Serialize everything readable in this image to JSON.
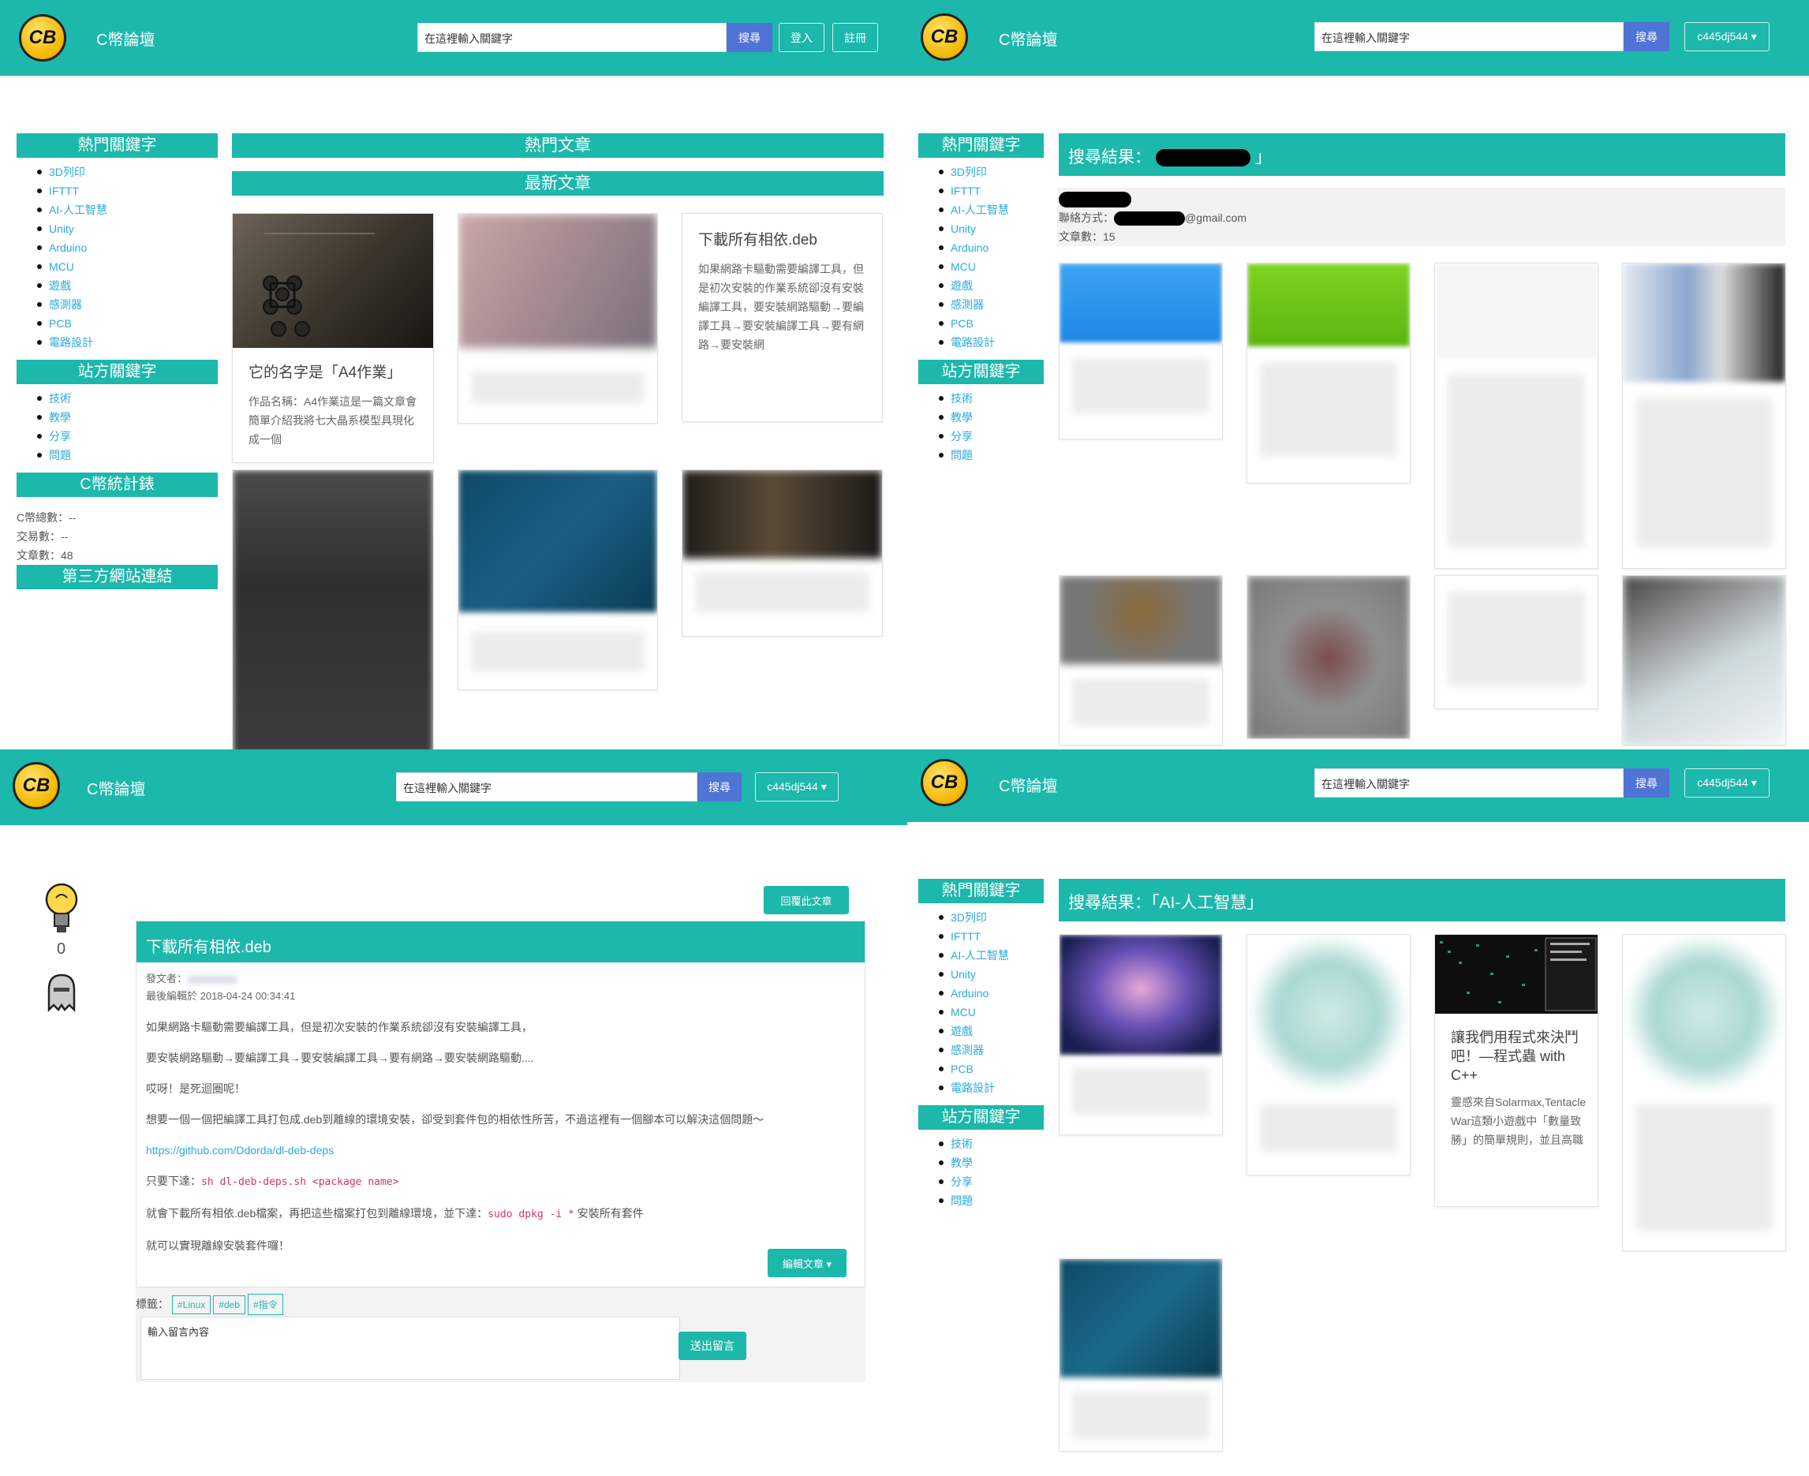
{
  "nav": {
    "brand": "C幣論壇",
    "logo_text": "CB",
    "search_placeholder": "在這裡輸入關鍵字",
    "search_btn": "搜尋",
    "login": "登入",
    "register": "註冊",
    "user_menu": "c445dj544 ▾"
  },
  "sidebar": {
    "hot_title": "熱門關鍵字",
    "hot_items": [
      "3D列印",
      "IFTTT",
      "AI-人工智慧",
      "Unity",
      "Arduino",
      "MCU",
      "遊戲",
      "感測器",
      "PCB",
      "電路設計"
    ],
    "site_title": "站方關鍵字",
    "site_items": [
      "技術",
      "教學",
      "分享",
      "問題"
    ],
    "stats_title": "C幣統計錶",
    "stats": [
      "C幣總數：--",
      "交易數：--",
      "文章數：48"
    ],
    "links_title": "第三方網站連結"
  },
  "home": {
    "hot_articles": "熱門文章",
    "latest_articles": "最新文章",
    "card1_title": "它的名字是「A4作業」",
    "card1_text": "作品名稱：A4作業這是一篇文章會簡單介紹我將七大晶系模型具現化成一個",
    "card3_title": "下載所有相依.deb",
    "card3_text": "如果網路卡驅動需要編譯工具，但是初次安裝的作業系統卻沒有安裝編譯工具，要安裝網路驅動→要編譯工具→要安裝編譯工具→要有網路→要安裝網"
  },
  "profile": {
    "result_label": "搜尋結果：",
    "result_close": "」",
    "contact_label": "聯絡方式：",
    "email_suffix": "@gmail.com",
    "article_count": "文章數：15"
  },
  "article": {
    "reply_btn": "回覆此文章",
    "title": "下載所有相依.deb",
    "author_label": "發文者：",
    "edited": "最後編輯於 2018-04-24 00:34:41",
    "vote_count": "0",
    "p1": "如果網路卡驅動需要編譯工具，但是初次安裝的作業系統卻沒有安裝編譯工具，",
    "p2": "要安裝網路驅動→要編譯工具→要安裝編譯工具→要有網路→要安裝網路驅動....",
    "p3": "哎呀！是死迴圈呢！",
    "p4": "想要一個一個把編譯工具打包成.deb到離線的環境安裝，卻受到套件包的相依性所苦，不過這裡有一個腳本可以解決這個問題～",
    "link": "https://github.com/Ddorda/dl-deb-deps",
    "p6_prefix": "只要下達：",
    "p6_code": "sh dl-deb-deps.sh <package name>",
    "p7_prefix": "就會下載所有相依.deb檔案，再把這些檔案打包到離線環境，並下達：",
    "p7_code": "sudo dpkg -i *",
    "p7_suffix": "安裝所有套件",
    "p8": "就可以實現離線安裝套件囉！",
    "edit_btn": "編輯文章 ▾",
    "tags_label": "標籤：",
    "tags": [
      "#Linux",
      "#deb",
      "#指令"
    ],
    "comment_placeholder": "輸入留言內容",
    "send_btn": "送出留言"
  },
  "search": {
    "result_title": "搜尋結果：「AI-人工智慧」",
    "card_title": "讓我們用程式來決鬥吧！—程式蟲 with C++",
    "card_text": "靈感來自Solarmax,Tentacle War這類小遊戲中「數量致勝」的簡單規則，並且高職"
  },
  "colors": {
    "teal": "#1cb8ab",
    "search_blue": "#4f74d6",
    "link": "#2aaadf"
  }
}
